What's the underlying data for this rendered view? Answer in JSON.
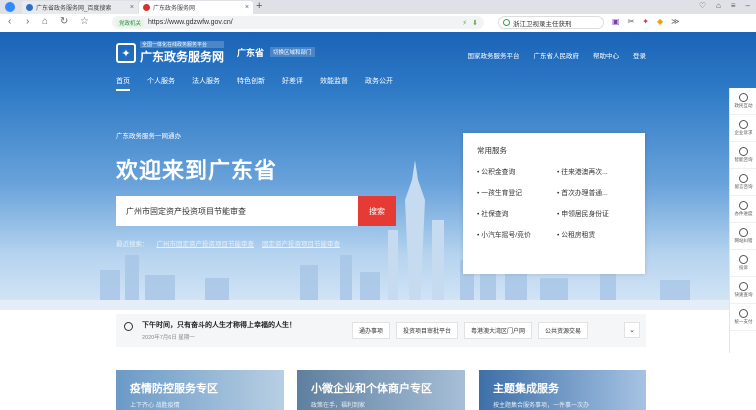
{
  "browser": {
    "tabs": [
      {
        "label": "广东省政务服务网_百度搜索"
      },
      {
        "label": "广东政务服务网"
      }
    ],
    "new_tab": "+",
    "url": "https://www.gdzwfw.gov.cn/",
    "secure_badge": "党政机关",
    "search_box": "浙江卫视录主任获刑"
  },
  "header": {
    "logo_small": "全国一体化在线政务服务平台",
    "logo_big": "广东政务服务网",
    "province": "广东省",
    "switch": "切换区域和部门",
    "toplinks": [
      "国家政务服务平台",
      "广东省人民政府",
      "帮助中心",
      "登录"
    ],
    "nav": [
      "首页",
      "个人服务",
      "法人服务",
      "特色创新",
      "好差评",
      "效能监督",
      "政务公开"
    ]
  },
  "hero": {
    "subtitle": "广东政务服务一网通办",
    "title": "欢迎来到广东省",
    "search_value": "广州市固定资产投资项目节能审查",
    "search_button": "搜索",
    "hot_label": "最近搜索：",
    "hot_items": [
      "广州市固定资产投资项目节能审查",
      "固定资产投资项目节能审查"
    ]
  },
  "common_services": {
    "title": "常用服务",
    "items": [
      "公积金查询",
      "往来港澳再次...",
      "一孩生育登记",
      "首次办理普通...",
      "社保查询",
      "申领居民身份证",
      "小汽车摇号/竞价",
      "公租房租赁"
    ]
  },
  "sidebar": [
    "政民互动",
    "企业诉求",
    "智能咨询",
    "留言咨询",
    "办件进度",
    "网站纠错",
    "投诉",
    "快速查询",
    "统一支付"
  ],
  "notice": {
    "message": "下午时间，只有奋斗的人生才称得上幸福的人生！",
    "date": "2020年7月6日 星期一",
    "buttons": [
      "通办事项",
      "投资项目审批平台",
      "粤港澳大湾区门户网",
      "公共资源交易"
    ],
    "more": "⌄"
  },
  "cards": [
    {
      "title": "疫情防控服务专区",
      "sub": "上下齐心 战胜疫情"
    },
    {
      "title": "小微企业和个体商户专区",
      "sub": "政策在手，福利到家"
    },
    {
      "title": "主题集成服务",
      "sub": "按主题集合服务事项，一件事一次办"
    }
  ]
}
